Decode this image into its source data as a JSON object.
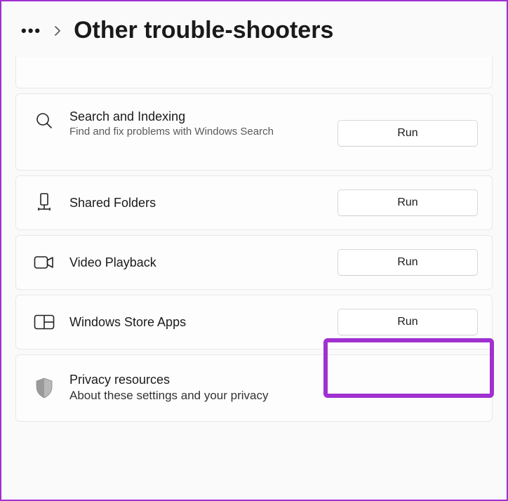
{
  "header": {
    "title": "Other trouble-shooters"
  },
  "items": [
    {
      "title": "Search and Indexing",
      "desc": "Find and fix problems with Windows Search",
      "button": "Run"
    },
    {
      "title": "Shared Folders",
      "desc": "",
      "button": "Run"
    },
    {
      "title": "Video Playback",
      "desc": "",
      "button": "Run"
    },
    {
      "title": "Windows Store Apps",
      "desc": "",
      "button": "Run"
    }
  ],
  "privacy": {
    "title": "Privacy resources",
    "desc": "About these settings and your privacy"
  }
}
